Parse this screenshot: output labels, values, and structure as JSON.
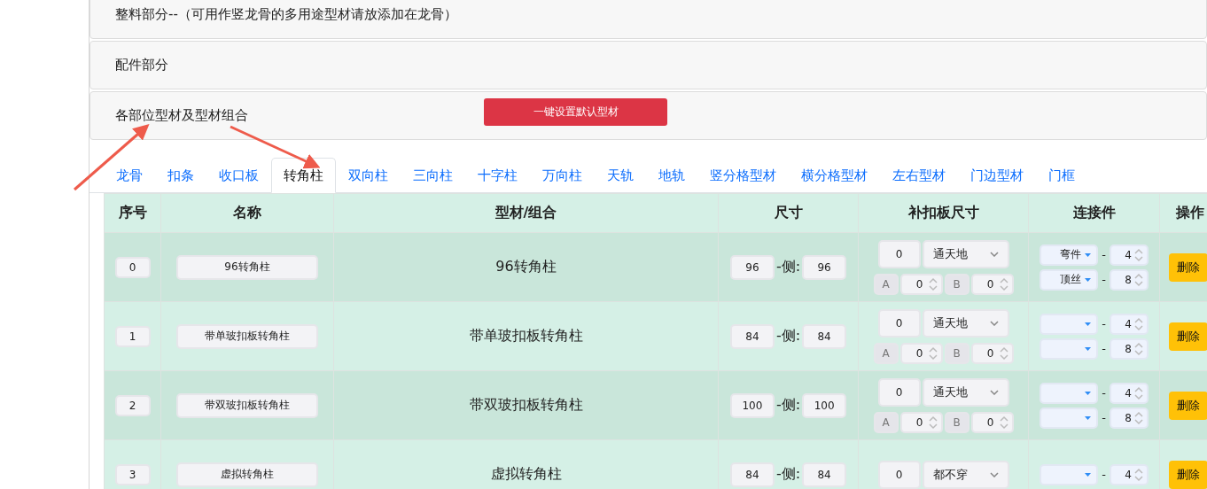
{
  "sections": [
    {
      "title": "整料部分--（可用作竖龙骨的多用途型材请放添加在龙骨）"
    },
    {
      "title": "配件部分"
    },
    {
      "title": "各部位型材及型材组合",
      "button": "一键设置默认型材"
    }
  ],
  "tabs": [
    {
      "label": "龙骨",
      "selected": false
    },
    {
      "label": "扣条",
      "selected": false
    },
    {
      "label": "收口板",
      "selected": false
    },
    {
      "label": "转角柱",
      "selected": true
    },
    {
      "label": "双向柱",
      "selected": false
    },
    {
      "label": "三向柱",
      "selected": false
    },
    {
      "label": "十字柱",
      "selected": false
    },
    {
      "label": "万向柱",
      "selected": false
    },
    {
      "label": "天轨",
      "selected": false
    },
    {
      "label": "地轨",
      "selected": false
    },
    {
      "label": "竖分格型材",
      "selected": false
    },
    {
      "label": "横分格型材",
      "selected": false
    },
    {
      "label": "左右型材",
      "selected": false
    },
    {
      "label": "门边型材",
      "selected": false
    },
    {
      "label": "门框",
      "selected": false
    }
  ],
  "table": {
    "columns": [
      "序号",
      "名称",
      "型材/组合",
      "尺寸",
      "补扣板尺寸",
      "连接件",
      "操作"
    ],
    "rows": [
      {
        "index": "0",
        "name": "96转角柱",
        "profile": "96转角柱",
        "size": "96",
        "side_label": "-侧:",
        "side": "96",
        "fill_size": "0",
        "fill_mode": "通天地",
        "a": {
          "label": "A",
          "value": "0"
        },
        "b": {
          "label": "B",
          "value": "0"
        },
        "connectors": [
          {
            "type": "弯件",
            "separator": "-",
            "qty": "4"
          },
          {
            "type": "顶丝",
            "separator": "-",
            "qty": "8"
          }
        ],
        "action": "删除"
      },
      {
        "index": "1",
        "name": "带单玻扣板转角柱",
        "profile": "带单玻扣板转角柱",
        "size": "84",
        "side_label": "-侧:",
        "side": "84",
        "fill_size": "0",
        "fill_mode": "通天地",
        "a": {
          "label": "A",
          "value": "0"
        },
        "b": {
          "label": "B",
          "value": "0"
        },
        "connectors": [
          {
            "separator": "-",
            "qty": "4"
          },
          {
            "separator": "-",
            "qty": "8"
          }
        ],
        "action": "删除"
      },
      {
        "index": "2",
        "name": "带双玻扣板转角柱",
        "profile": "带双玻扣板转角柱",
        "size": "100",
        "side_label": "-侧:",
        "side": "100",
        "fill_size": "0",
        "fill_mode": "通天地",
        "a": {
          "label": "A",
          "value": "0"
        },
        "b": {
          "label": "B",
          "value": "0"
        },
        "connectors": [
          {
            "separator": "-",
            "qty": "4"
          },
          {
            "separator": "-",
            "qty": "8"
          }
        ],
        "action": "删除"
      },
      {
        "index": "3",
        "name": "虚拟转角柱",
        "profile": "虚拟转角柱",
        "size": "84",
        "side_label": "-侧:",
        "side": "84",
        "fill_size": "0",
        "fill_mode": "都不穿",
        "connectors": [
          {
            "separator": "-",
            "qty": "4"
          }
        ],
        "action": "删除"
      }
    ]
  }
}
